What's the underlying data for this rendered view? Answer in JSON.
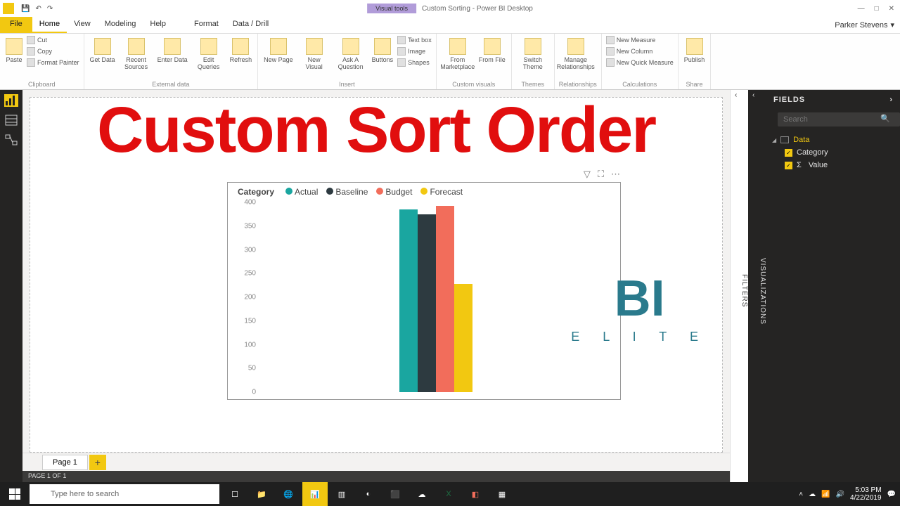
{
  "titlebar": {
    "visual_tools": "Visual tools",
    "window_title": "Custom Sorting - Power BI Desktop"
  },
  "win_ctrls": {
    "min": "—",
    "max": "□",
    "close": "✕"
  },
  "menubar": {
    "file": "File",
    "tabs": [
      "Home",
      "View",
      "Modeling",
      "Help",
      "Format",
      "Data / Drill"
    ],
    "active": "Home",
    "user": "Parker Stevens"
  },
  "ribbon": {
    "clipboard": {
      "paste": "Paste",
      "cut": "Cut",
      "copy": "Copy",
      "painter": "Format Painter",
      "label": "Clipboard"
    },
    "external": {
      "get": "Get Data",
      "recent": "Recent Sources",
      "enter": "Enter Data",
      "edit": "Edit Queries",
      "refresh": "Refresh",
      "label": "External data"
    },
    "insert": {
      "page": "New Page",
      "visual": "New Visual",
      "ask": "Ask A Question",
      "buttons": "Buttons",
      "textbox": "Text box",
      "image": "Image",
      "shapes": "Shapes",
      "label": "Insert"
    },
    "custom": {
      "marketplace": "From Marketplace",
      "file": "From File",
      "label": "Custom visuals"
    },
    "themes": {
      "switch": "Switch Theme",
      "label": "Themes"
    },
    "rel": {
      "manage": "Manage Relationships",
      "label": "Relationships"
    },
    "calc": {
      "measure": "New Measure",
      "column": "New Column",
      "quick": "New Quick Measure",
      "label": "Calculations"
    },
    "share": {
      "publish": "Publish",
      "label": "Share"
    }
  },
  "overlay": "Custom Sort Order",
  "chart_data": {
    "type": "bar",
    "legend_title": "Category",
    "series": [
      {
        "name": "Actual",
        "color": "#1aa6a0",
        "value": 385
      },
      {
        "name": "Baseline",
        "color": "#2d3a40",
        "value": 375
      },
      {
        "name": "Budget",
        "color": "#f26d5b",
        "value": 392
      },
      {
        "name": "Forecast",
        "color": "#f2c811",
        "value": 228
      }
    ],
    "ylim": [
      0,
      400
    ],
    "yticks": [
      0,
      50,
      100,
      150,
      200,
      250,
      300,
      350,
      400
    ]
  },
  "logo": {
    "big": "BI",
    "small": "E L I T E"
  },
  "side": {
    "filters": "FILTERS",
    "viz": "VISUALIZATIONS"
  },
  "fields": {
    "header": "FIELDS",
    "search_placeholder": "Search",
    "table": "Data",
    "cols": [
      "Category",
      "Value"
    ]
  },
  "pages": {
    "p1": "Page 1",
    "status": "PAGE 1 OF 1"
  },
  "taskbar": {
    "search": "Type here to search",
    "time": "5:03 PM",
    "date": "4/22/2019"
  }
}
